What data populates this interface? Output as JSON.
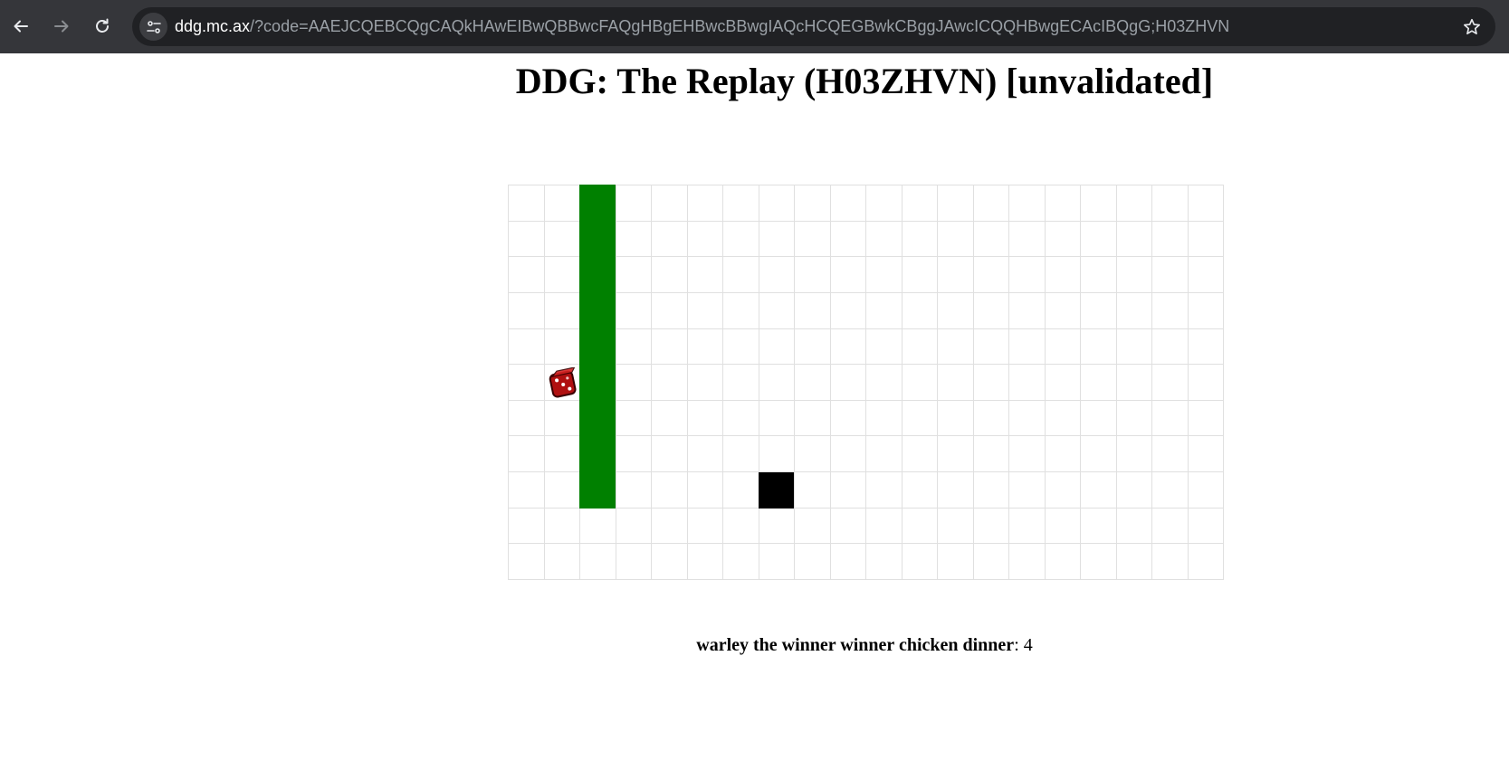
{
  "browser": {
    "url_host": "ddg.mc.ax",
    "url_path": "/?code=AAEJCQEBCQgCAQkHAwEIBwQBBwcFAQgHBgEHBwcBBwgIAQcHCQEGBwkCBggJAwcICQQHBwgECAcIBQgG;H03ZHVN",
    "icons": [
      "back-arrow-icon",
      "forward-arrow-icon",
      "reload-icon",
      "site-info-icon",
      "bookmark-star-icon"
    ]
  },
  "page": {
    "title": "DDG: The Replay (H03ZHVN) [unvalidated]"
  },
  "game": {
    "grid_columns": 20,
    "grid_rows": 11,
    "wall_color": "#008000",
    "wall_cells": {
      "column": 3,
      "rows_from": 1,
      "rows_to": 9
    },
    "block_cell": {
      "column": 8,
      "row": 9
    },
    "block_color": "#000000",
    "player_icon": "red-dice-icon",
    "player_cell": {
      "column": 2,
      "row": 6
    }
  },
  "score": {
    "name": "warley the winner winner chicken dinner",
    "separator": ": ",
    "value": "4"
  }
}
